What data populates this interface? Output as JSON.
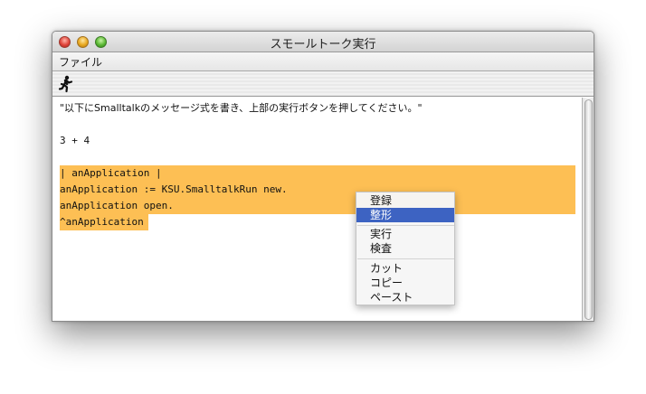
{
  "window": {
    "title": "スモールトーク実行"
  },
  "menubar": {
    "items": [
      {
        "label": "ファイル"
      }
    ]
  },
  "toolbar": {
    "run_icon": "running-figure-icon"
  },
  "editor": {
    "lines": [
      "\"以下にSmalltalkのメッセージ式を書き、上部の実行ボタンを押してください。\"",
      "",
      "3 + 4",
      "",
      "| anApplication |",
      "anApplication := KSU.SmalltalkRun new.",
      "anApplication open.",
      "^anApplication"
    ],
    "highlight_color": "#fdbf54"
  },
  "context_menu": {
    "items": [
      {
        "label": "登録",
        "selected": false
      },
      {
        "label": "整形",
        "selected": true
      },
      {
        "label": "実行",
        "selected": false
      },
      {
        "label": "検査",
        "selected": false
      },
      {
        "label": "カット",
        "selected": false
      },
      {
        "label": "コピー",
        "selected": false
      },
      {
        "label": "ペースト",
        "selected": false
      }
    ],
    "selection_color": "#3d63c2"
  }
}
